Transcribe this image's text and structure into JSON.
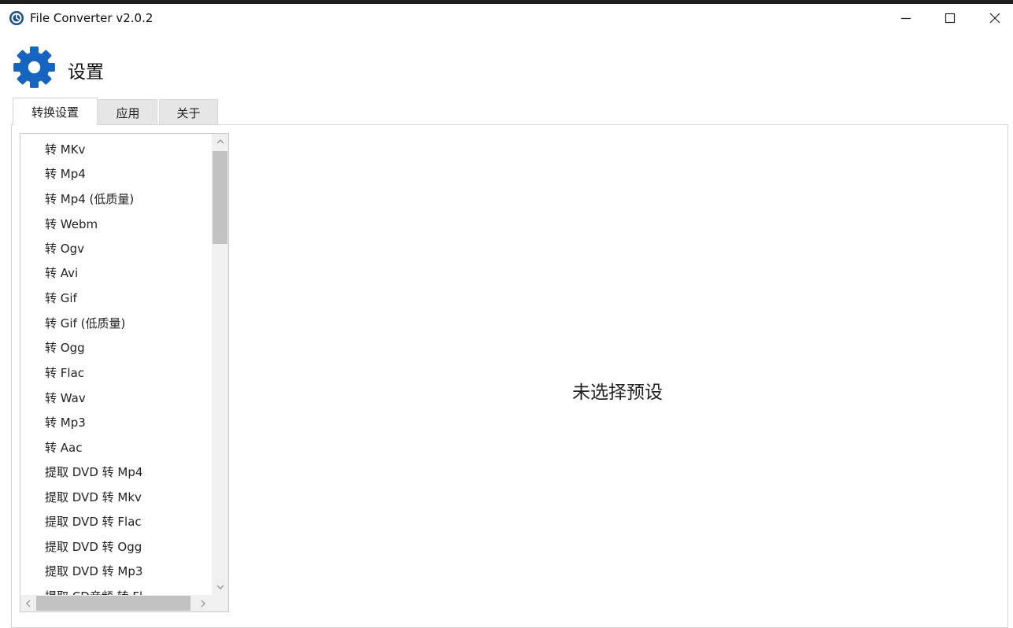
{
  "window": {
    "title": "File Converter v2.0.2",
    "controls": {
      "minimize": "minimize-icon",
      "maximize": "maximize-icon",
      "close": "close-icon"
    }
  },
  "header": {
    "icon": "gear-icon",
    "title": "设置"
  },
  "tabs": [
    {
      "label": "转换设置",
      "active": true
    },
    {
      "label": "应用",
      "active": false
    },
    {
      "label": "关于",
      "active": false
    }
  ],
  "presets": [
    "转 MKv",
    "转 Mp4",
    "转 Mp4 (低质量)",
    "转 Webm",
    "转 Ogv",
    "转 Avi",
    "转 Gif",
    "转 Gif (低质量)",
    "转 Ogg",
    "转 Flac",
    "转 Wav",
    "转 Mp3",
    "转 Aac",
    "提取 DVD 转 Mp4",
    "提取 DVD 转 Mkv",
    "提取 DVD 转 Flac",
    "提取 DVD 转 Ogg",
    "提取 DVD 转 Mp3",
    "提取 CD音频 转 Fl"
  ],
  "main": {
    "empty_message": "未选择预设"
  },
  "colors": {
    "accent": "#1565c0",
    "tab_inactive": "#e6e6e6",
    "scroll_thumb": "#c2c2c2"
  }
}
